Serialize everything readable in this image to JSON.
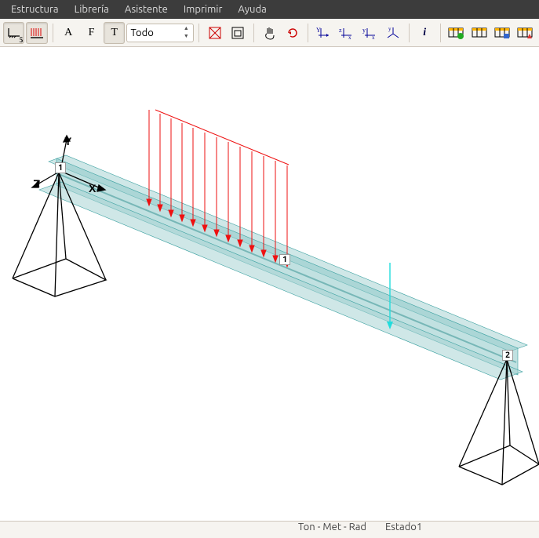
{
  "menu": {
    "items": [
      "Estructura",
      "Librería",
      "Asistente",
      "Imprimir",
      "Ayuda"
    ]
  },
  "toolbar": {
    "btn1_sub": "5",
    "letterA": "A",
    "letterF": "F",
    "letterT": "T",
    "filter_label": "Todo",
    "info": "i"
  },
  "viewport": {
    "axis_y": "Y",
    "axis_x": "X",
    "axis_z": "Z",
    "node1": "1",
    "node2": "2",
    "load1": "1"
  },
  "status": {
    "units": "Ton - Met - Rad",
    "state": "Estado1"
  }
}
